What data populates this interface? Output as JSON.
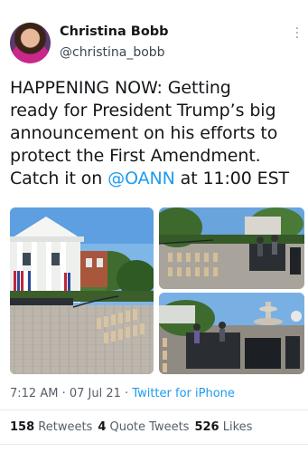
{
  "author": {
    "name": "Christina Bobb",
    "handle": "@christina_bobb"
  },
  "tweet": {
    "line1": "HAPPENING NOW: Getting",
    "line2": "ready for President Trump’s big",
    "line3": "announcement on his efforts to",
    "line4": "protect the First Amendment.",
    "line5_prefix": "Catch it on ",
    "line5_mention": "@OANN",
    "line5_suffix": " at 11:00 EST"
  },
  "meta": {
    "time": "7:12 AM",
    "sep1": " · ",
    "date": "07 Jul 21",
    "sep2": " · ",
    "source": "Twitter for iPhone"
  },
  "stats": {
    "retweets_count": "158",
    "retweets_label": " Retweets",
    "quotes_count": "4",
    "quotes_label": " Quote Tweets",
    "likes_count": "526",
    "likes_label": " Likes"
  },
  "colors": {
    "link": "#1d9bf0",
    "text": "#14171a",
    "secondary": "#56606a"
  },
  "icons": {
    "more": "more-vertical-icon"
  }
}
